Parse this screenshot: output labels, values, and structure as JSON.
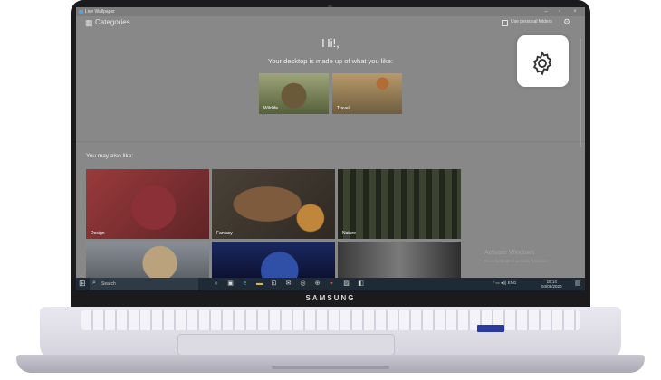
{
  "app": {
    "window_title": "Live Wallpaper",
    "window_controls": {
      "minimize": "–",
      "maximize": "▫",
      "close": "×"
    },
    "categories_label": "Categories",
    "personal_folders_label": "Use personal folders",
    "greeting": "Hi!,",
    "subtitle": "Your desktop is made up of what you like:",
    "selected_categories": [
      {
        "label": "Wildlife",
        "icon": "lion-photo"
      },
      {
        "label": "Travel",
        "icon": "hot-air-balloon-photo"
      }
    ],
    "may_also_like_label": "You may also like:",
    "suggestions": [
      {
        "label": "Design"
      },
      {
        "label": "Fantasy"
      },
      {
        "label": "Nature"
      },
      {
        "label": ""
      },
      {
        "label": ""
      },
      {
        "label": ""
      }
    ],
    "watermark": {
      "title": "Activate Windows",
      "subtitle": "Go to Settings to activate Windows."
    }
  },
  "taskbar": {
    "search_placeholder": "Search",
    "time": "15:14",
    "date": "04/06/2020",
    "tray_text": "^ ▭ ◀)) ENG"
  },
  "laptop": {
    "brand": "SAMSUNG"
  },
  "colors": {
    "accent_overlay": "#888888",
    "callout": "#ffffff",
    "taskbar": "#1e2a35"
  }
}
